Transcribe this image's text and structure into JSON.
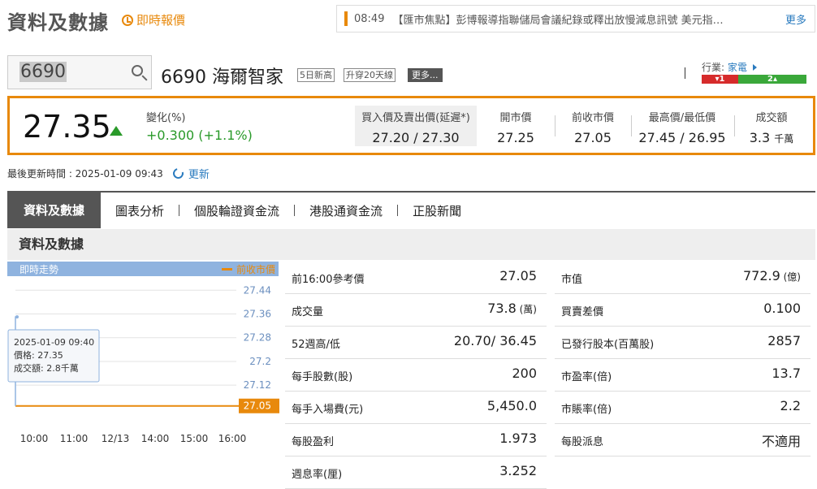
{
  "header": {
    "title": "資料及數據",
    "realtime_label": "即時報價",
    "news": {
      "time": "08:49",
      "text": "【匯市焦點】彭博報導指聯儲局會議紀錄或釋出放慢減息訊號 美元指…",
      "more": "更多"
    }
  },
  "search": {
    "value": "6690"
  },
  "stock": {
    "name": "6690 海爾智家",
    "tags": [
      "5日新高",
      "升穿20天線"
    ],
    "more": "更多...",
    "industry_label": "行業:",
    "industry_value": "家電",
    "industry_down": "▾1",
    "industry_up": "2▴",
    "industry_down_count": 1,
    "industry_up_count": 2
  },
  "quote": {
    "price": "27.35",
    "change_label": "變化(%)",
    "change_value": "+0.300 (+1.1%)",
    "bidask_label": "買入價及賣出價(延遲*)",
    "bidask_value": "27.20 / 27.30",
    "open_label": "開市價",
    "open_value": "27.25",
    "prevclose_label": "前收市價",
    "prevclose_value": "27.05",
    "hilo_label": "最高價/最低價",
    "hilo_value": "27.45 / 26.95",
    "turnover_label": "成交額",
    "turnover_value": "3.3",
    "turnover_unit": "千萬"
  },
  "update": {
    "text": "最後更新時間 : 2025-01-09 09:43",
    "refresh": "更新"
  },
  "tabs": [
    "資料及數據",
    "圖表分析",
    "個股輪證資金流",
    "港股通資金流",
    "正股新聞"
  ],
  "section_title": "資料及數據",
  "chart_data": {
    "type": "line",
    "title": "即時走勢",
    "legend": "前收市價",
    "x_ticks": [
      "10:00",
      "11:00",
      "12/13",
      "14:00",
      "15:00",
      "16:00"
    ],
    "y_ticks": [
      "27.44",
      "27.36",
      "27.28",
      "27.2",
      "27.12",
      "27.05"
    ],
    "ylim": [
      27.0,
      27.46
    ],
    "prev_close": 27.05,
    "series": [
      {
        "values": [
          27.05,
          27.35
        ]
      }
    ],
    "tooltip": {
      "time": "2025-01-09 09:40",
      "price": "價格: 27.35",
      "turnover": "成交額: 2.8千萬"
    },
    "colors": {
      "line": "#8fb3df",
      "prev_close": "#e8890c",
      "axis_label": "#6b8fbf"
    }
  },
  "table_left": [
    {
      "k": "前16:00參考價",
      "v": "27.05",
      "u": ""
    },
    {
      "k": "成交量",
      "v": "73.8",
      "u": "(萬)"
    },
    {
      "k": "52週高/低",
      "v": "20.70/ 36.45",
      "u": ""
    },
    {
      "k": "每手股數(股)",
      "v": "200",
      "u": ""
    },
    {
      "k": "每手入場費(元)",
      "v": "5,450.0",
      "u": ""
    },
    {
      "k": "每股盈利",
      "v": "1.973",
      "u": ""
    },
    {
      "k": "週息率(厘)",
      "v": "3.252",
      "u": ""
    }
  ],
  "table_right": [
    {
      "k": "市值",
      "v": "772.9",
      "u": "(億)"
    },
    {
      "k": "買賣差價",
      "v": "0.100",
      "u": ""
    },
    {
      "k": "已發行股本(百萬股)",
      "v": "2857",
      "u": ""
    },
    {
      "k": "市盈率(倍)",
      "v": "13.7",
      "u": ""
    },
    {
      "k": "市賬率(倍)",
      "v": "2.2",
      "u": ""
    },
    {
      "k": "每股派息",
      "v": "不適用",
      "u": ""
    }
  ],
  "colors": {
    "accent": "#e8890c",
    "up": "#2a9a2a",
    "down": "#d62b2b",
    "link": "#2a7bbf"
  }
}
